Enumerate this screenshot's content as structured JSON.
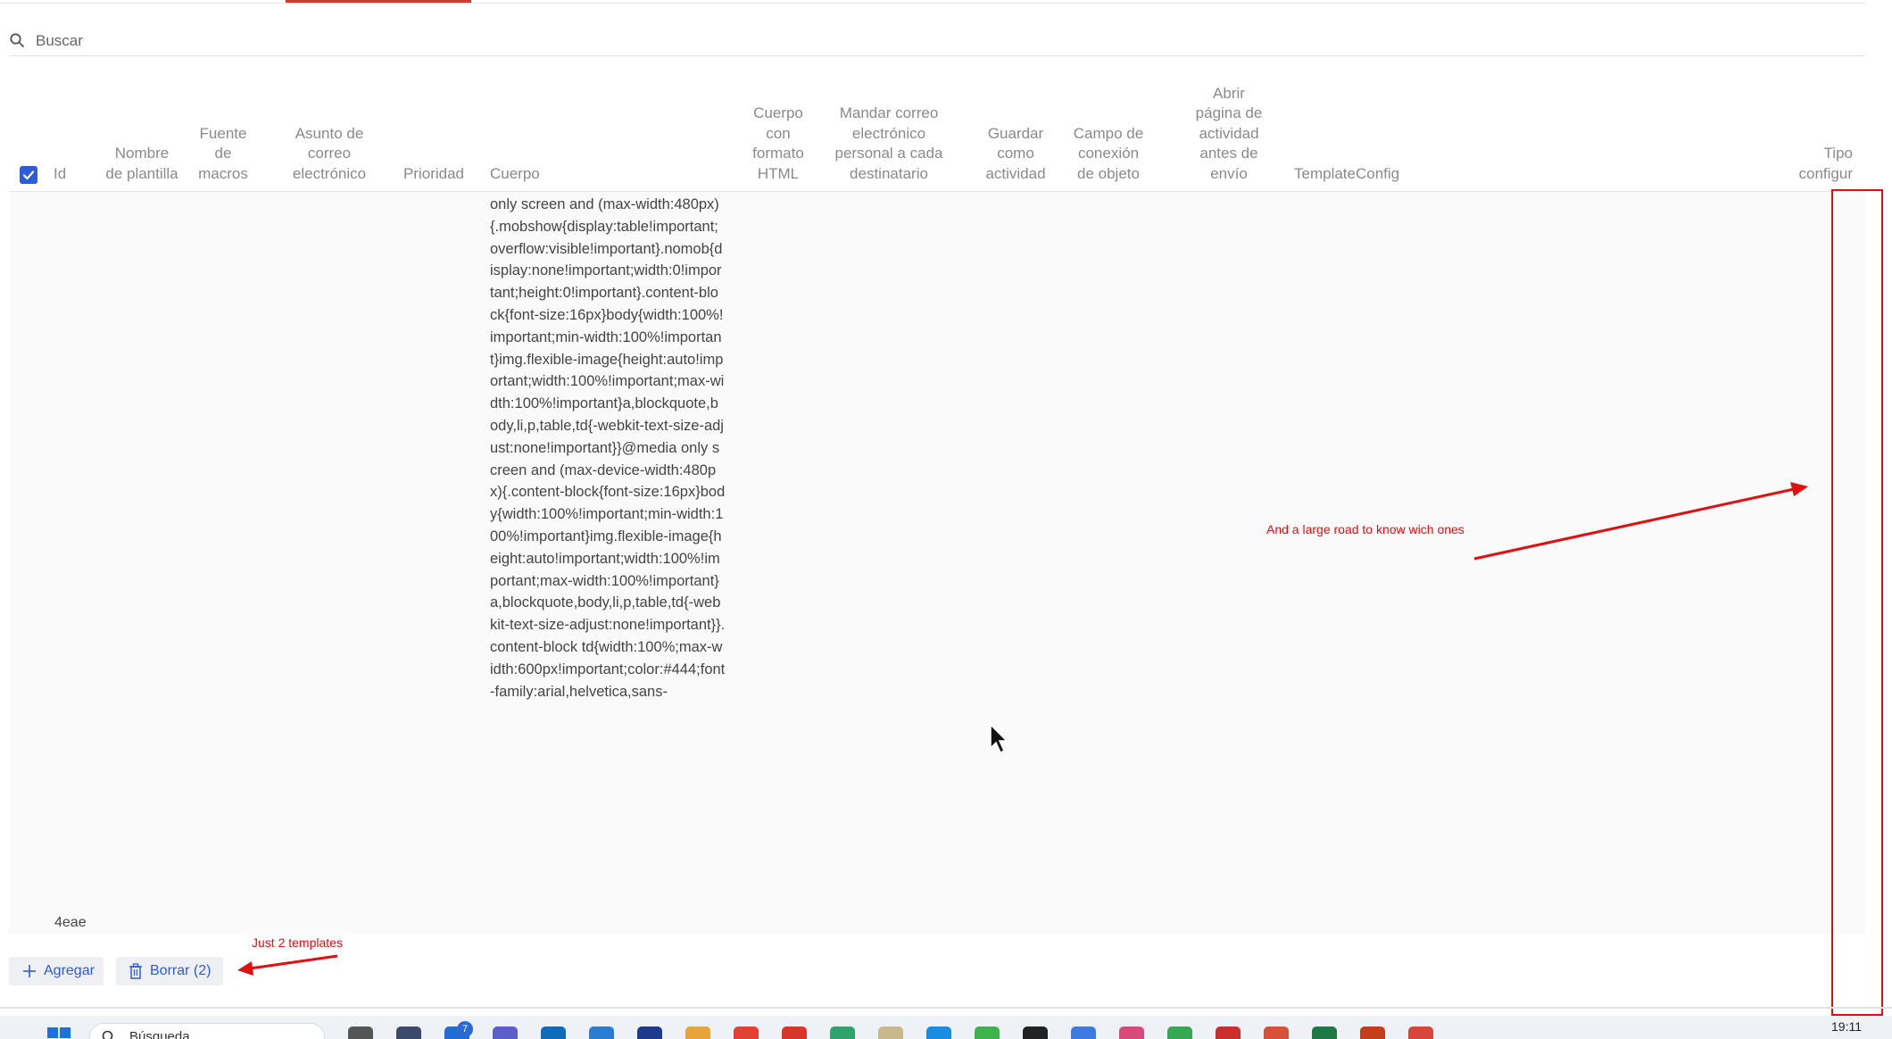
{
  "search": {
    "placeholder": "Buscar",
    "value": ""
  },
  "table": {
    "headers": {
      "id": "Id",
      "nombre_de_plantilla": "Nombre de plantilla",
      "fuente_de_macros": "Fuente de macros",
      "asunto_de_correo": "Asunto de correo electrónico",
      "prioridad": "Prioridad",
      "cuerpo": "Cuerpo",
      "cuerpo_html": "Cuerpo con formato HTML",
      "mandar_correo": "Mandar correo electrónico personal a cada destinatario",
      "guardar_actividad": "Guardar como actividad",
      "campo_conexion": "Campo de conexión de objeto",
      "abrir_pagina": "Abrir página de actividad antes de envío",
      "template_config": "TemplateConfig",
      "tipo_config": "Tipo configur"
    },
    "select_all_checked": true,
    "rows": [
      {
        "id": "4eae",
        "body": "only screen and (max-width:480px){.mobshow{display:table!important;overflow:visible!important}.nomob{display:none!important;width:0!important;height:0!important}.content-block{font-size:16px}body{width:100%!important;min-width:100%!important}img.flexible-image{height:auto!important;width:100%!important;max-width:100%!important}a,blockquote,body,li,p,table,td{-webkit-text-size-adjust:none!important}}@media only screen and (max-device-width:480px){.content-block{font-size:16px}body{width:100%!important;min-width:100%!important}img.flexible-image{height:auto!important;width:100%!important;max-width:100%!important}a,blockquote,body,li,p,table,td{-webkit-text-size-adjust:none!important}}.content-block td{width:100%;max-width:600px!important;color:#444;font-family:arial,helvetica,sans-"
      }
    ]
  },
  "actions": {
    "add_label": "Agregar",
    "delete_label": "Borrar (2)"
  },
  "annotations": {
    "road": "And a large road to know wich ones",
    "templates": "Just 2 templates"
  },
  "taskbar": {
    "search_placeholder": "Búsqueda",
    "badge_count": "7",
    "clock": "19:11"
  },
  "colors": {
    "accent": "#2e5bd8",
    "annotation": "#e01010",
    "tab_indicator": "#c8402a"
  }
}
